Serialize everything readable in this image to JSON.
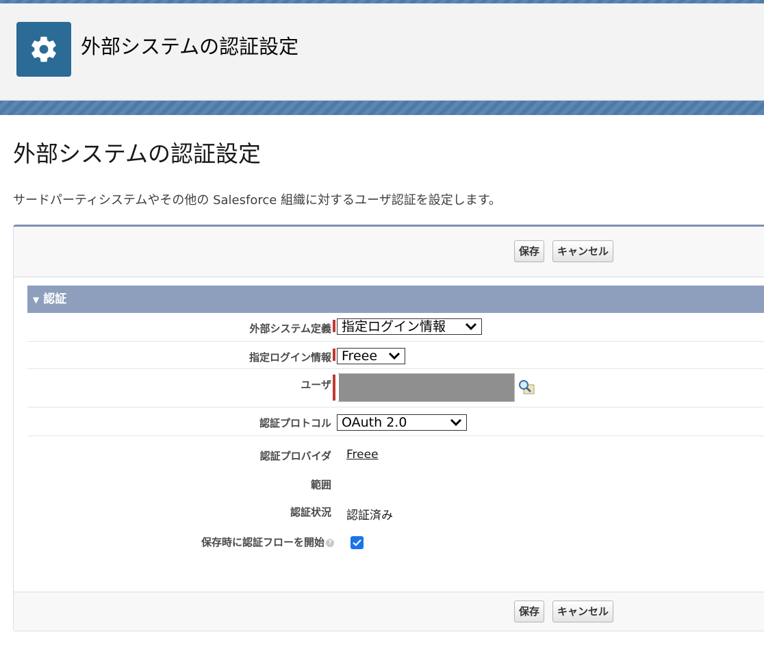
{
  "header": {
    "title": "外部システムの認証設定",
    "icon": "gear-icon",
    "icon_color": "#2b6b96"
  },
  "page": {
    "title": "外部システムの認証設定",
    "description": "サードパーティシステムやその他の Salesforce 組織に対するユーザ認証を設定します。"
  },
  "buttons": {
    "save": "保存",
    "cancel": "キャンセル"
  },
  "section": {
    "title": "認証",
    "color": "#8e9fbd"
  },
  "fields": {
    "external_system": {
      "label": "外部システム定義",
      "value": "指定ログイン情報"
    },
    "named_credential": {
      "label": "指定ログイン情報",
      "value": "Freee"
    },
    "user": {
      "label": "ユーザ"
    },
    "protocol": {
      "label": "認証プロトコル",
      "value": "OAuth 2.0"
    },
    "provider": {
      "label": "認証プロバイダ",
      "value": "Freee"
    },
    "scope": {
      "label": "範囲",
      "value": ""
    },
    "status": {
      "label": "認証状況",
      "value": "認証済み"
    },
    "start_flow": {
      "label": "保存時に認証フローを開始",
      "checked": true
    }
  }
}
